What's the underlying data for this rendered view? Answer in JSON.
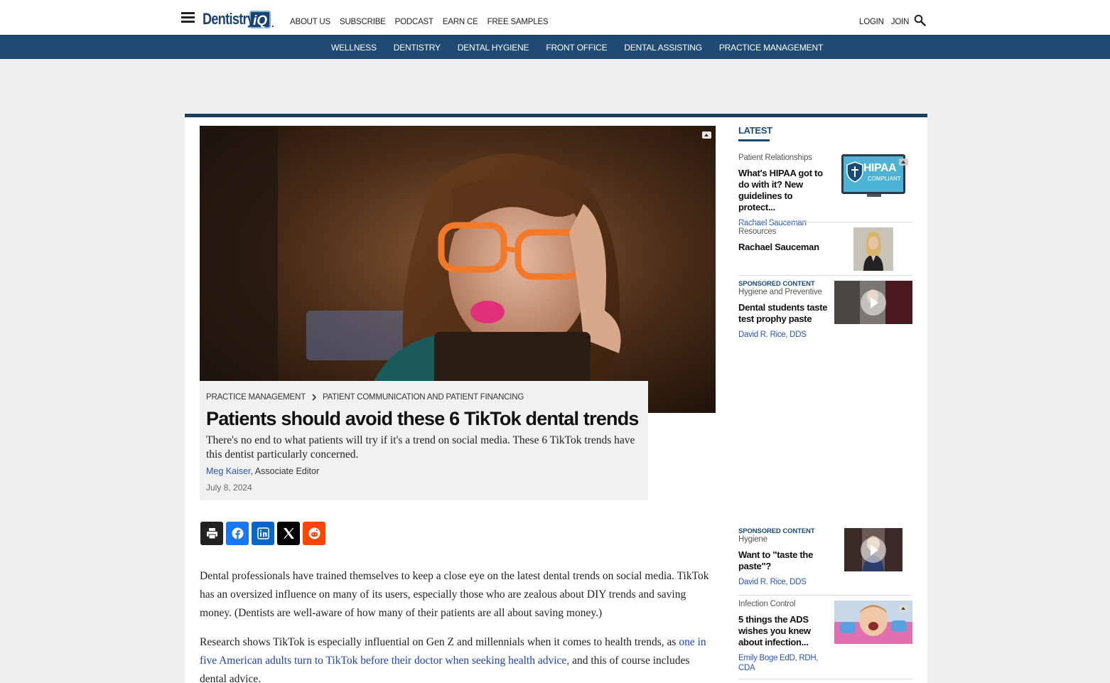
{
  "header": {
    "logo_text": "Dentistry",
    "logo_badge": "iQ",
    "logo_dot": ".",
    "nav": [
      "ABOUT US",
      "SUBSCRIBE",
      "PODCAST",
      "EARN CE",
      "FREE SAMPLES"
    ],
    "login": "LOGIN",
    "join": "JOIN"
  },
  "categories": [
    "WELLNESS",
    "DENTISTRY",
    "DENTAL HYGIENE",
    "FRONT OFFICE",
    "DENTAL ASSISTING",
    "PRACTICE MANAGEMENT"
  ],
  "article": {
    "breadcrumb": [
      "PRACTICE MANAGEMENT",
      "PATIENT COMMUNICATION AND PATIENT FINANCING"
    ],
    "title": "Patients should avoid these 6 TikTok dental trends",
    "dek": "There's no end to what patients will try if it's a trend on social media. These 6 TikTok trends have this dentist particularly concerned.",
    "author": "Meg Kaiser",
    "author_role": ", Associate Editor",
    "date": "July 8, 2024",
    "share": [
      "print",
      "facebook",
      "linkedin",
      "x",
      "reddit"
    ],
    "paragraph1": "Dental professionals have trained themselves to keep a close eye on the latest dental trends on social media. TikTok has an oversized influence on many of its users, especially those who are zealous about DIY trends and saving money. (Dentists are well-aware of how many of their patients are all about saving money.)",
    "paragraph2_before": "Research shows TikTok is especially influential on Gen Z and millennials when it comes to health trends, as ",
    "paragraph2_link": "one in five American adults turn to TikTok before their doctor when seeking health advice,",
    "paragraph2_after": " and this of course includes dental advice."
  },
  "sidebar": {
    "heading": "LATEST",
    "items": [
      {
        "sponsored": "",
        "category": "Patient Relationships",
        "title": "What's HIPAA got to do with it? New guidelines to protect...",
        "author": "Rachael Sauceman",
        "thumb_text": "HIPAA",
        "thumb_sub": "COMPLIANT"
      },
      {
        "sponsored": "",
        "category": "Resources",
        "title": "Rachael Sauceman",
        "author": ""
      },
      {
        "sponsored": "SPONSORED CONTENT",
        "category": "Hygiene and Preventive",
        "title": "Dental students taste test prophy paste",
        "author": "David R. Rice, DDS"
      },
      {
        "sponsored": "SPONSORED CONTENT",
        "category": "Hygiene",
        "title": "Want to \"taste the paste\"?",
        "author": "David R. Rice, DDS"
      },
      {
        "sponsored": "",
        "category": "Infection Control",
        "title": "5 things the ADS wishes you knew about infection...",
        "author": "Emily Boge EdD, RDH, CDA"
      }
    ]
  },
  "colors": {
    "brand_navy": "#1e4a73",
    "link_blue": "#2a55b8",
    "facebook": "#1877f2",
    "linkedin": "#0a66c2",
    "reddit": "#ff4500"
  }
}
